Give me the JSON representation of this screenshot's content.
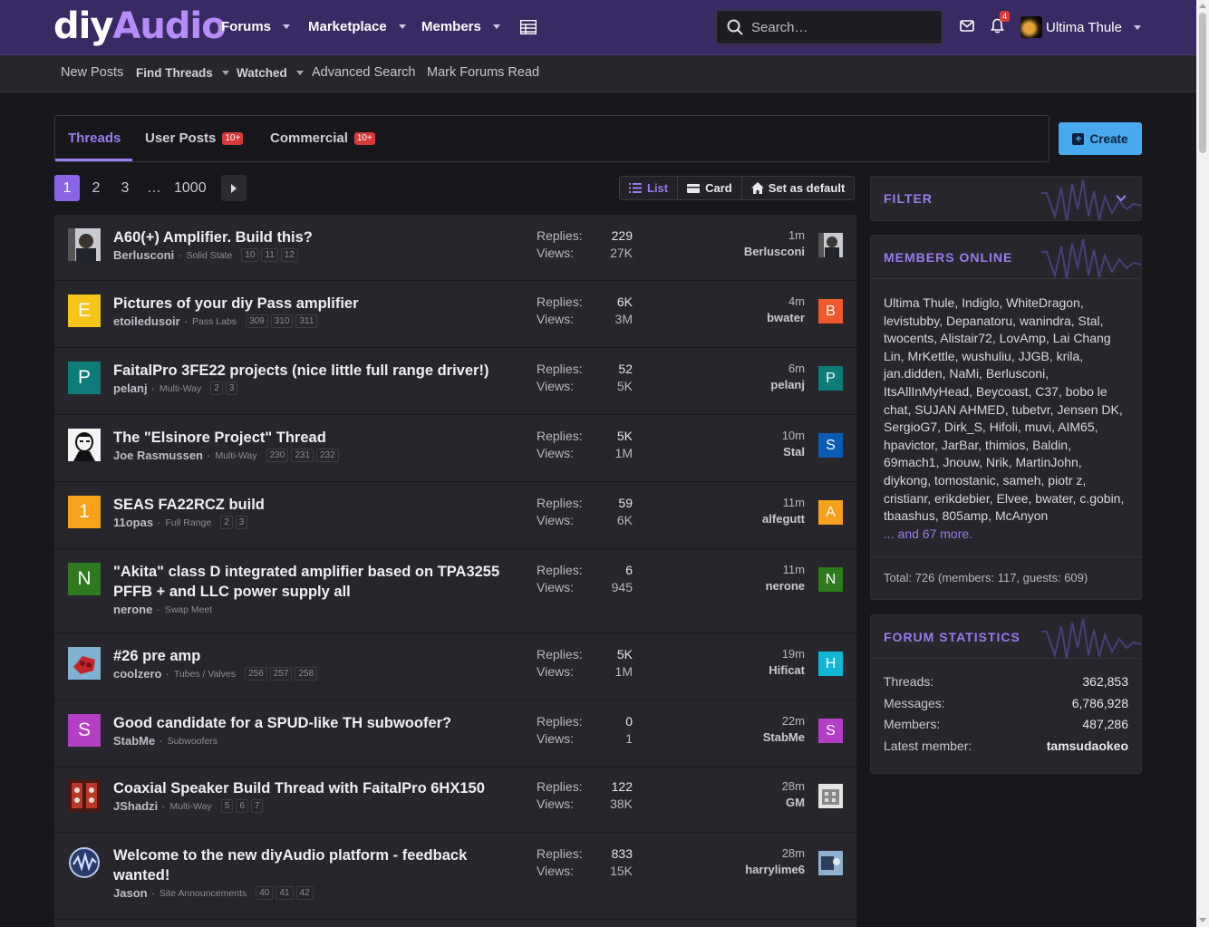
{
  "logo": {
    "diy": "diy",
    "audio": "Audio"
  },
  "nav": [
    {
      "label": "Forums"
    },
    {
      "label": "Marketplace"
    },
    {
      "label": "Members"
    }
  ],
  "search": {
    "placeholder": "Search…"
  },
  "notifications": {
    "count": "4"
  },
  "user": {
    "name": "Ultima Thule"
  },
  "subnav": {
    "new_posts": "New Posts",
    "find_threads": "Find Threads",
    "watched": "Watched",
    "advanced_search": "Advanced Search",
    "mark_read": "Mark Forums Read"
  },
  "tabs": [
    {
      "label": "Threads",
      "badge": ""
    },
    {
      "label": "User Posts",
      "badge": "10+"
    },
    {
      "label": "Commercial",
      "badge": "10+"
    }
  ],
  "create": {
    "label": "Create"
  },
  "pager": {
    "pages": [
      "1",
      "2",
      "3",
      "…",
      "1000"
    ],
    "current": "1"
  },
  "view": {
    "list": "List",
    "card": "Card",
    "default": "Set as default"
  },
  "threads": [
    {
      "title": "A60(+) Amplifier. Build this?",
      "author": "Berlusconi",
      "forum": "Solid State",
      "pages": [
        "10",
        "11",
        "12"
      ],
      "replies": "229",
      "views": "27K",
      "time": "1m",
      "last_user": "Berlusconi",
      "avatar_letter": "",
      "avatar_color": "#444",
      "last_letter": "",
      "last_color": "#444"
    },
    {
      "title": "Pictures of your diy Pass amplifier",
      "author": "etoiledusoir",
      "forum": "Pass Labs",
      "pages": [
        "309",
        "310",
        "311"
      ],
      "replies": "6K",
      "views": "3M",
      "time": "4m",
      "last_user": "bwater",
      "avatar_letter": "E",
      "avatar_color": "#f5c518",
      "last_letter": "B",
      "last_color": "#f0592a"
    },
    {
      "title": "FaitalPro 3FE22 projects (nice little full range driver!)",
      "author": "pelanj",
      "forum": "Multi-Way",
      "pages": [
        "2",
        "3"
      ],
      "replies": "52",
      "views": "5K",
      "time": "6m",
      "last_user": "pelanj",
      "avatar_letter": "P",
      "avatar_color": "#0e7c78",
      "last_letter": "P",
      "last_color": "#0e7c78"
    },
    {
      "title": "The \"Elsinore Project\" Thread",
      "author": "Joe Rasmussen",
      "forum": "Multi-Way",
      "pages": [
        "230",
        "231",
        "232"
      ],
      "replies": "5K",
      "views": "1M",
      "time": "10m",
      "last_user": "Stal",
      "avatar_letter": "",
      "avatar_color": "#fff",
      "last_letter": "S",
      "last_color": "#0a5bb5"
    },
    {
      "title": "SEAS FA22RCZ build",
      "author": "11opas",
      "forum": "Full Range",
      "pages": [
        "2",
        "3"
      ],
      "replies": "59",
      "views": "6K",
      "time": "11m",
      "last_user": "alfegutt",
      "avatar_letter": "1",
      "avatar_color": "#f7a21b",
      "last_letter": "A",
      "last_color": "#f7a21b"
    },
    {
      "title": "\"Akita\" class D integrated amplifier based on TPA3255 PFFB + and LLC power supply all",
      "author": "nerone",
      "forum": "Swap Meet",
      "pages": [],
      "replies": "6",
      "views": "945",
      "time": "11m",
      "last_user": "nerone",
      "avatar_letter": "N",
      "avatar_color": "#2f7a1e",
      "last_letter": "N",
      "last_color": "#2f7a1e"
    },
    {
      "title": "#26 pre amp",
      "author": "coolzero",
      "forum": "Tubes / Valves",
      "pages": [
        "256",
        "257",
        "258"
      ],
      "replies": "5K",
      "views": "1M",
      "time": "19m",
      "last_user": "Hificat",
      "avatar_letter": "",
      "avatar_color": "#6fa6c9",
      "last_letter": "H",
      "last_color": "#12b6d6"
    },
    {
      "title": "Good candidate for a SPUD-like TH subwoofer?",
      "author": "StabMe",
      "forum": "Subwoofers",
      "pages": [],
      "replies": "0",
      "views": "1",
      "time": "22m",
      "last_user": "StabMe",
      "avatar_letter": "S",
      "avatar_color": "#b43ec6",
      "last_letter": "S",
      "last_color": "#b43ec6"
    },
    {
      "title": "Coaxial Speaker Build Thread with FaitalPro 6HX150",
      "author": "JShadzi",
      "forum": "Multi-Way",
      "pages": [
        "5",
        "6",
        "7"
      ],
      "replies": "122",
      "views": "38K",
      "time": "28m",
      "last_user": "GM",
      "avatar_letter": "",
      "avatar_color": "#a33326",
      "last_letter": "",
      "last_color": "#ddd"
    },
    {
      "title": "Welcome to the new diyAudio platform - feedback wanted!",
      "author": "Jason",
      "forum": "Site Announcements",
      "pages": [
        "40",
        "41",
        "42"
      ],
      "replies": "833",
      "views": "15K",
      "time": "28m",
      "last_user": "harrylime6",
      "avatar_letter": "",
      "avatar_color": "#2a3a6a",
      "last_letter": "",
      "last_color": "#5a7aa0"
    }
  ],
  "labels": {
    "replies": "Replies:",
    "views": "Views:"
  },
  "sidebar": {
    "filter": {
      "title": "FILTER"
    },
    "members_online": {
      "title": "MEMBERS ONLINE",
      "names": "Ultima Thule, Indiglo, WhiteDragon, levistubby, Depanatoru, wanindra, Stal, twocents, Alistair72, LovAmp, Lai Chang Lin, MrKettle, wushuliu, JJGB, krila, jan.didden, NaMi, Berlusconi, ItsAllInMyHead, Beycoast, C37, bobo le chat, SUJAN AHMED, tubetvr, Jensen DK, SergioG7, Dirk_S, Hifoli, muvi, AIM65, hpavictor, JarBar, thimios, Baldin, 69mach1, Jnouw, Nrik, MartinJohn, diykong, tomostanic, sameh, piotr z, cristianr, erikdebier, Elvee, bwater, c.gobin, tbaashus, 805amp, McAnyon",
      "more": "... and 67 more.",
      "total": "Total: 726 (members: 117, guests: 609)"
    },
    "forum_stats": {
      "title": "FORUM STATISTICS",
      "rows": [
        {
          "k": "Threads:",
          "v": "362,853"
        },
        {
          "k": "Messages:",
          "v": "6,786,928"
        },
        {
          "k": "Members:",
          "v": "487,286"
        },
        {
          "k": "Latest member:",
          "v": "tamsudaokeo"
        }
      ]
    }
  },
  "colors": {
    "accent": "#9b7bf0",
    "topbar": "#3a2a63",
    "create": "#47a9f0",
    "badge": "#d83a3a"
  }
}
